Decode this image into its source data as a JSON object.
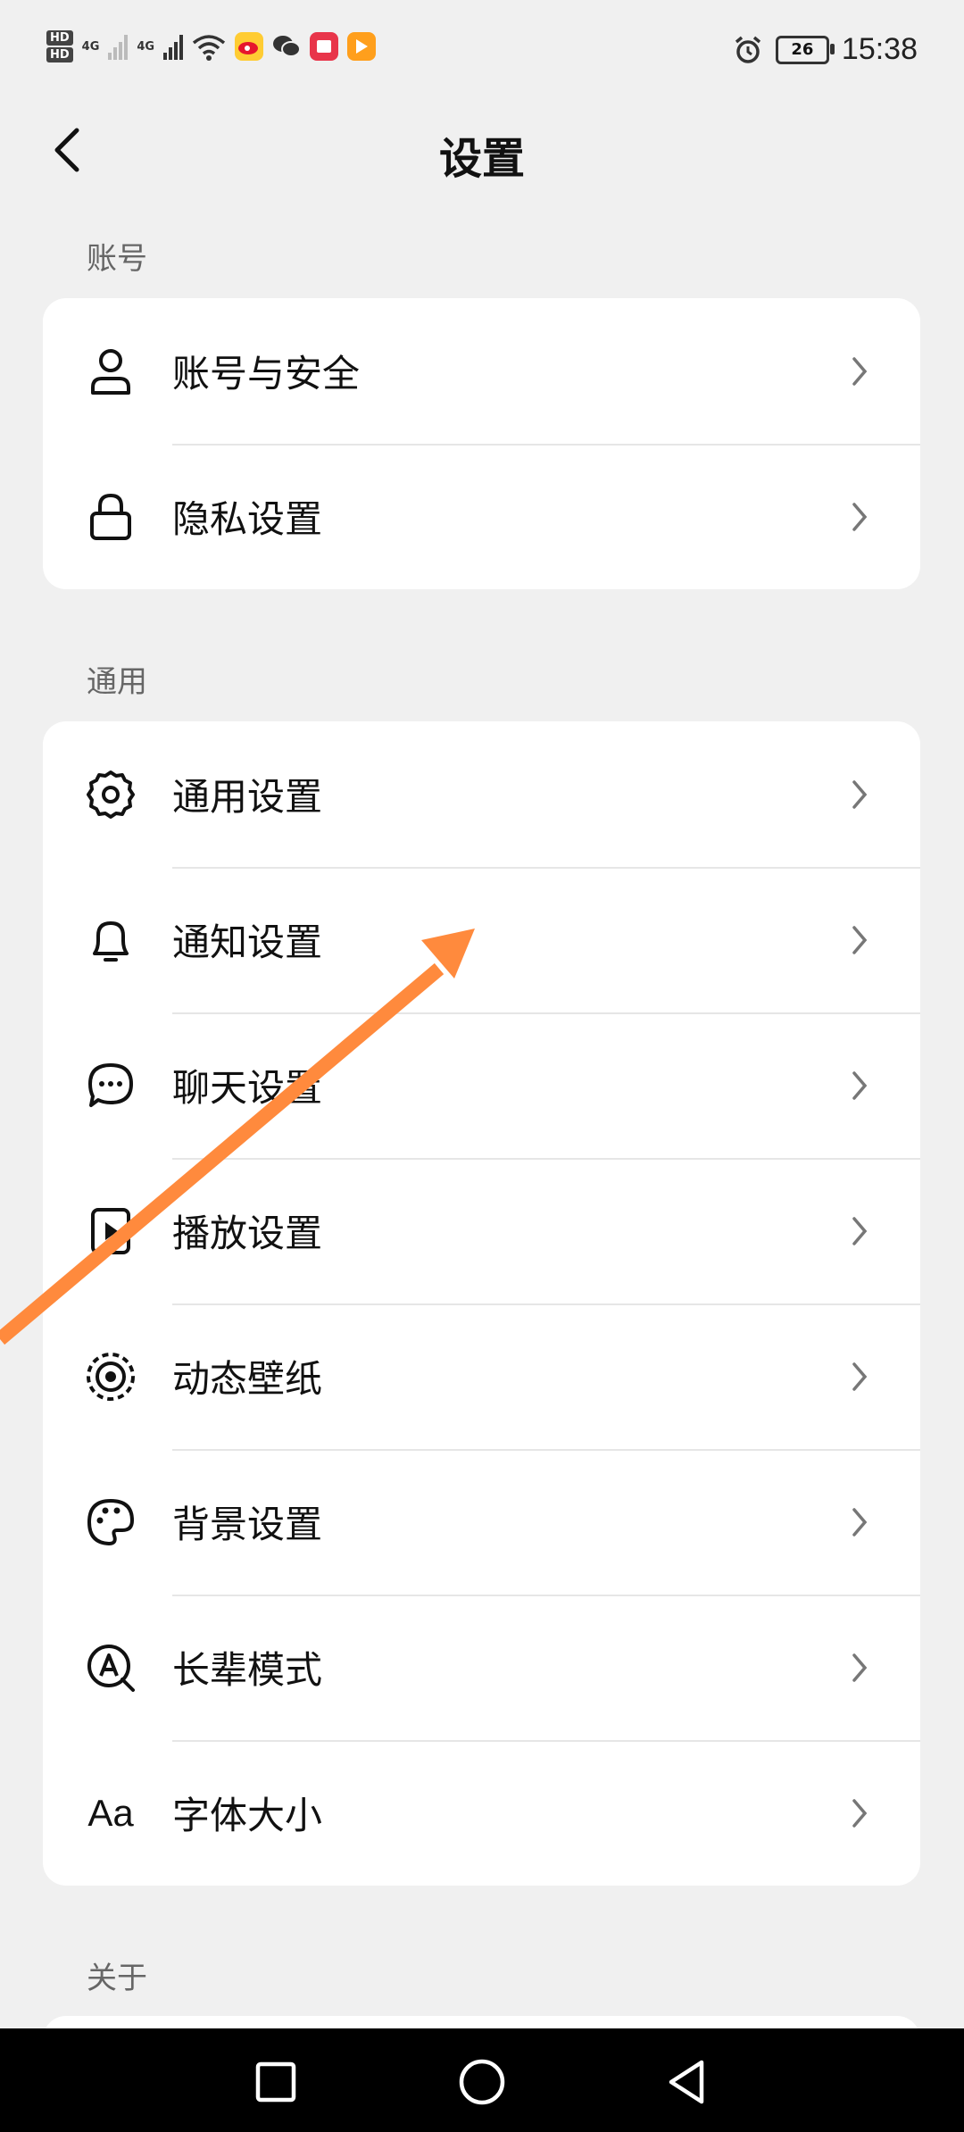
{
  "status_bar": {
    "hd_top": "HD",
    "hd_bottom": "HD",
    "net1": "4G",
    "net2": "4G",
    "battery": "26",
    "time": "15:38"
  },
  "header": {
    "title": "设置"
  },
  "sections": {
    "account": {
      "label": "账号",
      "items": [
        {
          "label": "账号与安全",
          "icon": "user-icon"
        },
        {
          "label": "隐私设置",
          "icon": "lock-icon"
        }
      ]
    },
    "general": {
      "label": "通用",
      "items": [
        {
          "label": "通用设置",
          "icon": "gear-icon"
        },
        {
          "label": "通知设置",
          "icon": "bell-icon"
        },
        {
          "label": "聊天设置",
          "icon": "chat-bubble-icon"
        },
        {
          "label": "播放设置",
          "icon": "play-icon"
        },
        {
          "label": "动态壁纸",
          "icon": "live-wallpaper-icon"
        },
        {
          "label": "背景设置",
          "icon": "palette-icon"
        },
        {
          "label": "长辈模式",
          "icon": "elder-mode-icon"
        },
        {
          "label": "字体大小",
          "icon": "font-size-icon",
          "icon_text": "Aa"
        }
      ]
    },
    "about": {
      "label": "关于"
    }
  },
  "colors": {
    "background": "#f0f0f0",
    "card": "#ffffff",
    "annotation_arrow": "#ff8a3d",
    "navbar": "#000000"
  }
}
